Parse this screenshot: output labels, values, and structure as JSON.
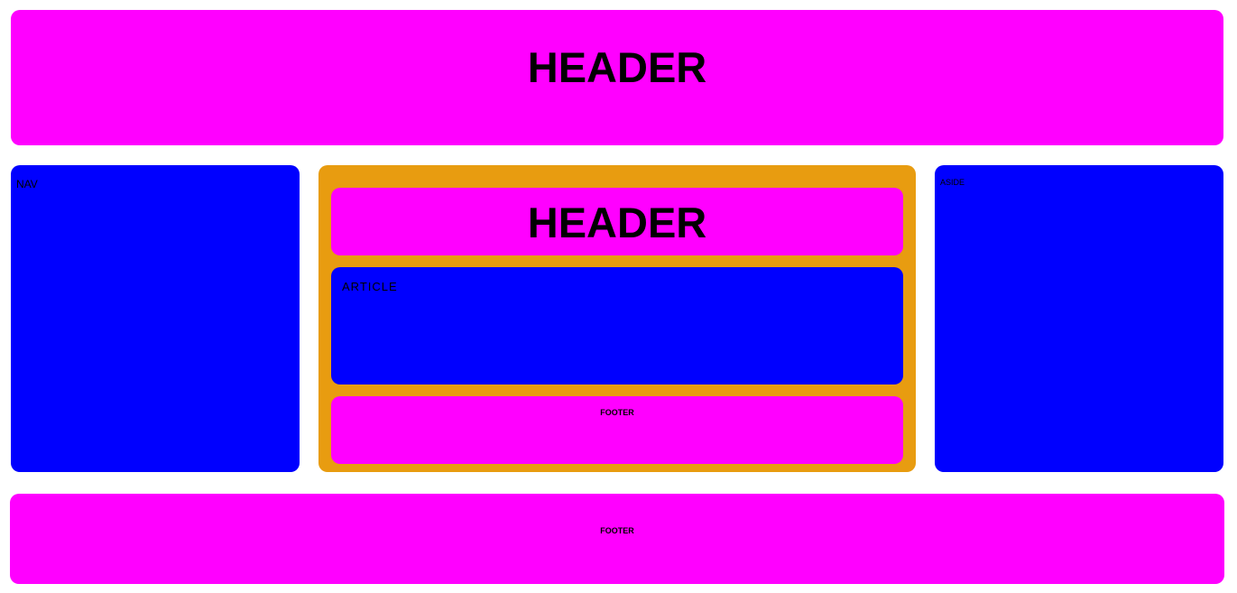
{
  "header": {
    "title": "HEADER"
  },
  "nav": {
    "label": "NAV"
  },
  "main": {
    "header": {
      "title": "HEADER"
    },
    "article": {
      "label": "ARTICLE"
    },
    "footer": {
      "label": "FOOTER"
    }
  },
  "aside": {
    "label": "ASIDE"
  },
  "footer": {
    "label": "FOOTER"
  },
  "colors": {
    "magenta": "#ff00ff",
    "blue": "#0000ff",
    "orange": "#e89c10"
  }
}
